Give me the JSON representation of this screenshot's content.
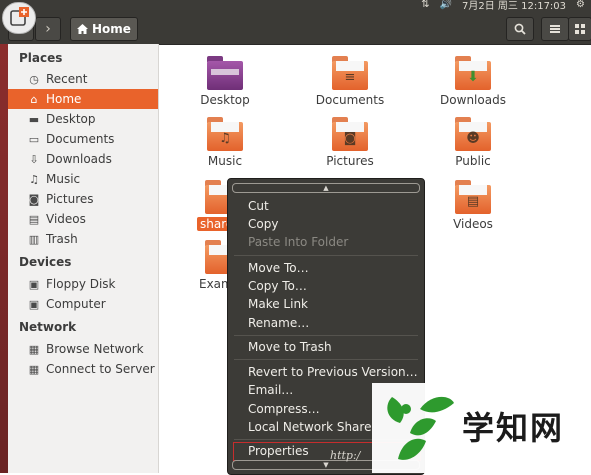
{
  "top_panel": {
    "clock": "7月2日 周三 12:17:03"
  },
  "toolbar": {
    "location": "Home"
  },
  "sidebar": {
    "sections": [
      {
        "title": "Places",
        "items": [
          "Recent",
          "Home",
          "Desktop",
          "Documents",
          "Downloads",
          "Music",
          "Pictures",
          "Videos",
          "Trash"
        ]
      },
      {
        "title": "Devices",
        "items": [
          "Floppy Disk",
          "Computer"
        ]
      },
      {
        "title": "Network",
        "items": [
          "Browse Network",
          "Connect to Server"
        ]
      }
    ],
    "active_item": "Home"
  },
  "content": {
    "folders": [
      "Desktop",
      "Documents",
      "Downloads",
      "Music",
      "Pictures",
      "Public",
      "share",
      "Videos",
      "Exam"
    ]
  },
  "context_menu": {
    "items": [
      "Cut",
      "Copy",
      "Paste Into Folder",
      "Move To…",
      "Copy To…",
      "Make Link",
      "Rename…",
      "Move to Trash",
      "Revert to Previous Version…",
      "Email…",
      "Compress…",
      "Local Network Share",
      "Properties"
    ],
    "disabled": [
      "Paste Into Folder"
    ],
    "highlighted": "Properties"
  },
  "watermark": {
    "text": "学知网",
    "url": "http:/"
  },
  "colors": {
    "accent": "#e9632b",
    "panel": "#3c3b37",
    "sidebar": "#f2f1f0",
    "menu": "#3c3b37",
    "highlight_border": "#c62d2d",
    "watermark_green": "#2e9a2e"
  }
}
